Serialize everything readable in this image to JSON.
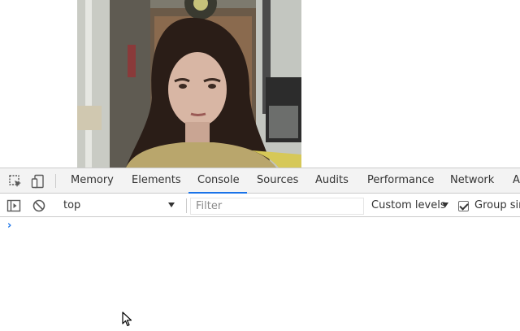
{
  "devtools": {
    "tabs": [
      {
        "label": "Memory",
        "active": false
      },
      {
        "label": "Elements",
        "active": false
      },
      {
        "label": "Console",
        "active": true
      },
      {
        "label": "Sources",
        "active": false
      },
      {
        "label": "Audits",
        "active": false
      },
      {
        "label": "Performance",
        "active": false
      },
      {
        "label": "Network",
        "active": false
      },
      {
        "label": "A",
        "active": false
      }
    ],
    "accent_color": "#1a73e8"
  },
  "console_toolbar": {
    "context": "top",
    "filter_placeholder": "Filter",
    "filter_value": "",
    "levels_label": "Custom levels",
    "group_label": "Group sim",
    "group_checked": true
  },
  "console": {
    "prompt_symbol": "›"
  },
  "icons": {
    "inspect": "inspect-element-icon",
    "device": "device-toolbar-icon",
    "sidebar": "show-sidebar-icon",
    "clear": "clear-console-icon"
  }
}
